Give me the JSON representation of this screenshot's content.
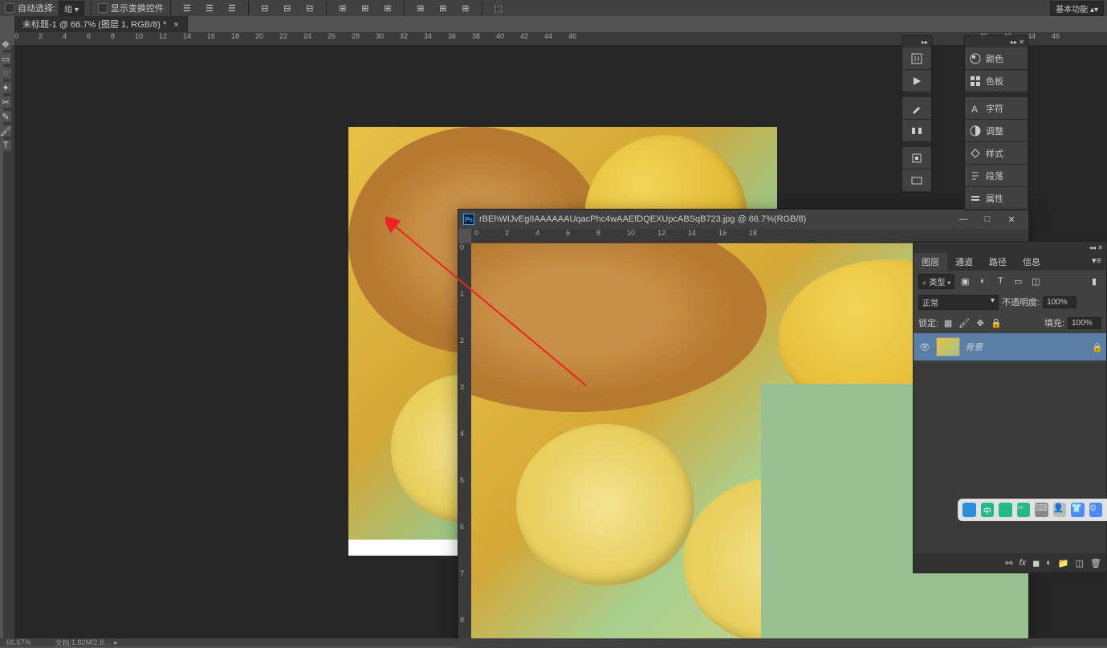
{
  "top_bar": {
    "auto_select": "自动选择:",
    "layer_opt": "组",
    "show_transform": "显示变换控件",
    "basic_mode": "基本功能"
  },
  "doc_tab": {
    "title": "未标题-1 @ 66.7% (图层 1, RGB/8) *",
    "close": "×"
  },
  "float_win": {
    "ps": "Ps",
    "title": "rBEhWIJvEgIIAAAAAAUqacPhc4wAAEfDQEXUpcABSqB723.jpg @ 66.7%(RGB/8)",
    "min": "—",
    "max": "□",
    "close": "✕"
  },
  "side_panels": {
    "color": "颜色",
    "swatches": "色板",
    "character": "字符",
    "adjustments": "调整",
    "styles": "样式",
    "paragraph": "段落",
    "properties": "属性"
  },
  "layers": {
    "tabs": {
      "layers": "图层",
      "channels": "通道",
      "paths": "路径",
      "info": "信息"
    },
    "filter_label": "类型",
    "filter_search": "⌕",
    "blend_mode": "正常",
    "opacity_label": "不透明度:",
    "opacity_val": "100%",
    "lock_label": "锁定:",
    "fill_label": "填充:",
    "fill_val": "100%",
    "layer_name": "背景"
  },
  "status": {
    "zoom": "66.67%",
    "doc_size_label": "文档:",
    "doc_size": "1.82M/2.8…"
  },
  "ruler_ticks": [
    "0",
    "2",
    "4",
    "6",
    "8",
    "10",
    "12",
    "14",
    "16",
    "18",
    "20",
    "22",
    "24",
    "26",
    "28",
    "30",
    "32",
    "34",
    "36",
    "38",
    "40",
    "42",
    "44",
    "46"
  ],
  "float_ruler_ticks": [
    "0",
    "2",
    "4",
    "6",
    "8",
    "10",
    "12",
    "14",
    "16",
    "18"
  ],
  "float_ruler_v": [
    "0",
    "1",
    "2",
    "3",
    "4",
    "5",
    "6",
    "7",
    "8"
  ],
  "ruler_ticks_far": [
    "40",
    "42",
    "44",
    "46"
  ]
}
